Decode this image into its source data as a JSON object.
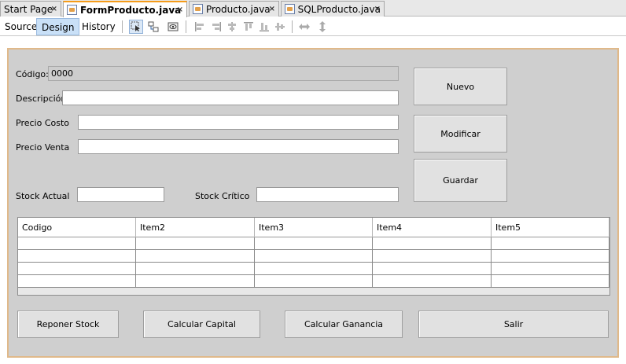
{
  "tabs": [
    {
      "label": "Start Page",
      "active": false,
      "icon": "none"
    },
    {
      "label": "FormProducto.java",
      "active": true,
      "icon": "form-file-icon"
    },
    {
      "label": "Producto.java",
      "active": false,
      "icon": "java-file-icon"
    },
    {
      "label": "SQLProducto.java",
      "active": false,
      "icon": "java-file-icon"
    }
  ],
  "close_glyph": "×",
  "view_tabs": {
    "source": "Source",
    "design": "Design",
    "history": "History"
  },
  "toolbar_icons": [
    "selection-mode-icon",
    "connection-mode-icon",
    "preview-design-icon",
    "align-left-icon",
    "align-right-icon",
    "center-horizontal-icon",
    "align-top-icon",
    "align-bottom-icon",
    "center-vertical-icon",
    "resize-horizontal-icon",
    "resize-vertical-icon"
  ],
  "form": {
    "codigo_label": "Código:",
    "codigo_value": "0000",
    "descripcion_label": "Descripción",
    "precio_costo_label": "Precio Costo",
    "precio_venta_label": "Precio Venta",
    "stock_actual_label": "Stock Actual",
    "stock_critico_label": "Stock Crítico",
    "buttons": {
      "nuevo": "Nuevo",
      "modificar": "Modificar",
      "guardar": "Guardar",
      "reponer": "Reponer Stock",
      "capital": "Calcular Capital",
      "ganancia": "Calcular Ganancia",
      "salir": "Salir"
    },
    "table": {
      "columns": [
        "Codigo",
        "Item2",
        "Item3",
        "Item4",
        "Item5"
      ],
      "rows": [
        [
          "",
          "",
          "",
          "",
          ""
        ],
        [
          "",
          "",
          "",
          "",
          ""
        ],
        [
          "",
          "",
          "",
          "",
          ""
        ],
        [
          "",
          "",
          "",
          "",
          ""
        ]
      ]
    }
  },
  "colors": {
    "accent_tab": "#f59c1a",
    "form_bg": "#cfcfcf",
    "form_border": "#e0b98a",
    "design_tab_bg": "#c9e0f7"
  }
}
